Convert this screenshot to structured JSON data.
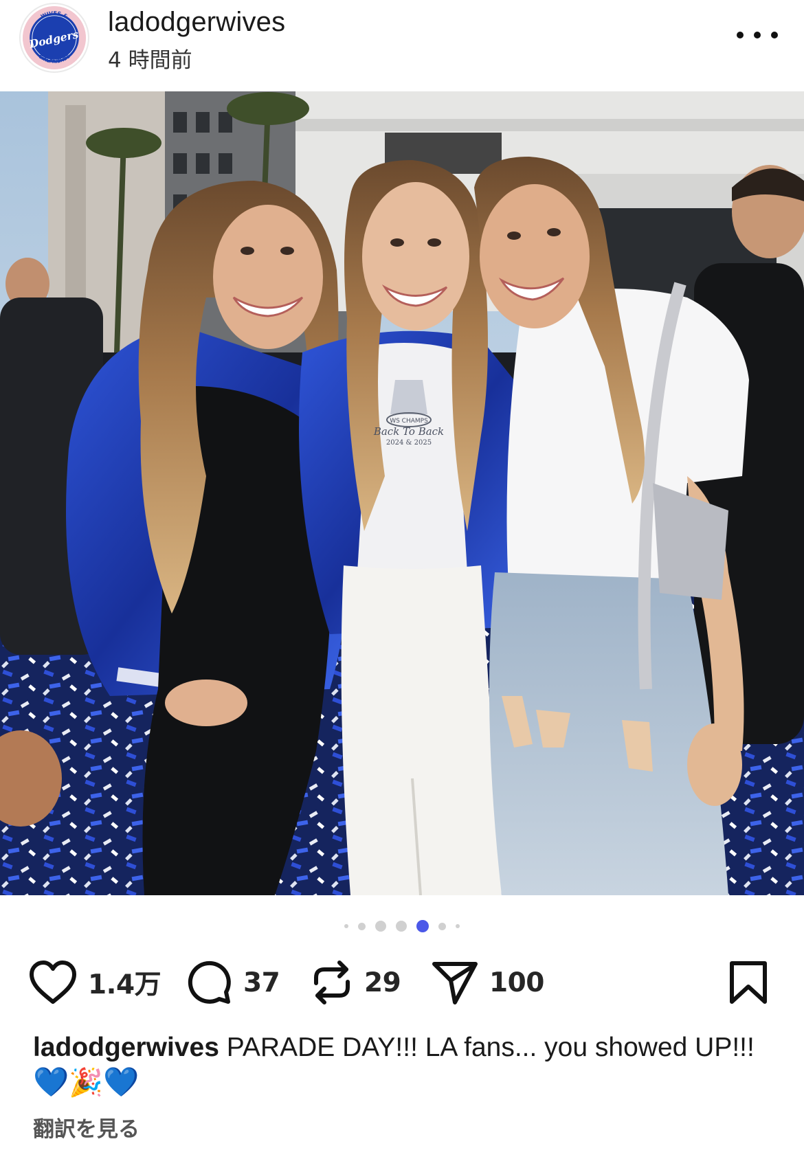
{
  "header": {
    "username": "ladodgerwives",
    "timestamp": "4 時間前",
    "avatar_text": {
      "arc_top": "WIVES &",
      "center": "Dodgers",
      "arc_bottom": "GIRLFRIENDS"
    }
  },
  "carousel": {
    "total": 7,
    "active_index": 4
  },
  "actions": {
    "likes": "1.4万",
    "comments": "37",
    "reposts": "29",
    "shares": "100"
  },
  "caption": {
    "username": "ladodgerwives",
    "text": "PARADE DAY!!! LA fans... you showed UP!!!",
    "emoji_1": "💙",
    "emoji_2": "🎉",
    "emoji_3": "💙"
  },
  "translate_link": "翻訳を見る",
  "photo_text": {
    "shirt_line1": "WS CHAMPS",
    "shirt_line2": "Back To Back",
    "shirt_line3": "2024 & 2025"
  },
  "colors": {
    "dodger_blue": "#1b3fb0",
    "active_dot": "#4b58e8",
    "avatar_pink": "#f2c6cf"
  },
  "icons": [
    "more-icon",
    "heart-icon",
    "comment-icon",
    "repost-icon",
    "share-icon",
    "bookmark-icon"
  ]
}
